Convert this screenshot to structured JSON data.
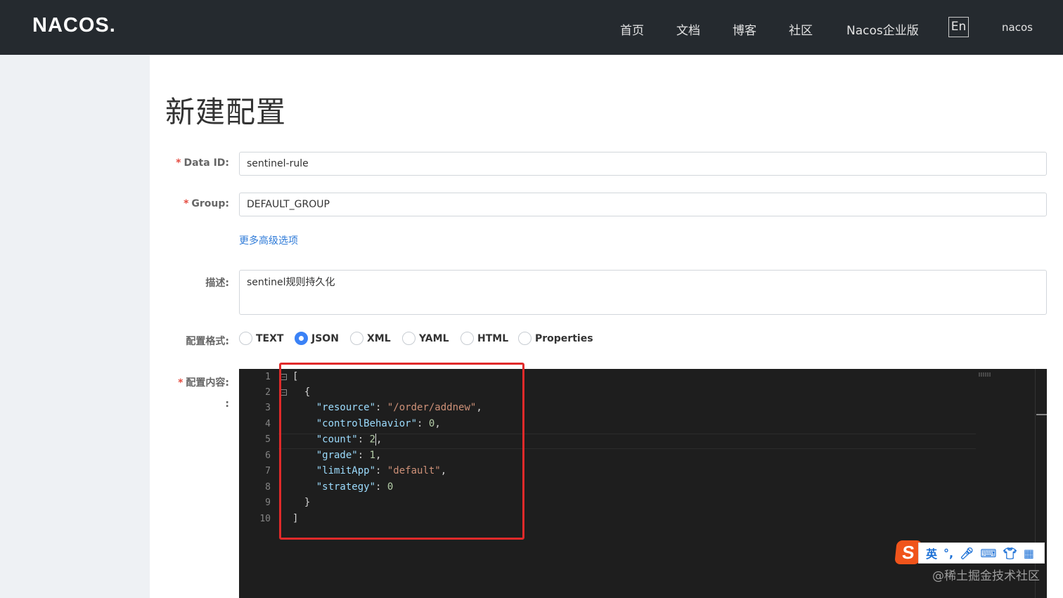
{
  "header": {
    "logo": "NACOS.",
    "nav": [
      "首页",
      "文档",
      "博客",
      "社区",
      "Nacos企业版"
    ],
    "lang_button": "En",
    "user": "nacos"
  },
  "page": {
    "title": "新建配置"
  },
  "form": {
    "data_id": {
      "label": "Data ID:",
      "value": "sentinel-rule"
    },
    "group": {
      "label": "Group:",
      "value": "DEFAULT_GROUP"
    },
    "advanced_link": "更多高级选项",
    "description": {
      "label": "描述:",
      "value": "sentinel规则持久化"
    },
    "format": {
      "label": "配置格式:",
      "options": [
        "TEXT",
        "JSON",
        "XML",
        "YAML",
        "HTML",
        "Properties"
      ],
      "selected": "JSON"
    },
    "content": {
      "label": "配置内容:",
      "sub_label": ":",
      "line_numbers": [
        "1",
        "2",
        "3",
        "4",
        "5",
        "6",
        "7",
        "8",
        "9",
        "10"
      ]
    }
  },
  "code": {
    "open_bracket": "[",
    "open_brace": "{",
    "lines": [
      {
        "key": "\"resource\"",
        "value": "\"/order/addnew\""
      },
      {
        "key": "\"controlBehavior\"",
        "value": "0"
      },
      {
        "key": "\"count\"",
        "value": "2"
      },
      {
        "key": "\"grade\"",
        "value": "1"
      },
      {
        "key": "\"limitApp\"",
        "value": "\"default\""
      },
      {
        "key": "\"strategy\"",
        "value": "0"
      }
    ],
    "close_brace": "}",
    "close_bracket": "]"
  },
  "ime": {
    "logo": "S",
    "mode": "英"
  },
  "watermark": "@稀土掘金技术社区",
  "colors": {
    "topbar": "#252a2f",
    "accent": "#3b82f6",
    "link": "#2f7bd8",
    "required": "#e54d42",
    "highlight_box": "#e02a2a"
  }
}
